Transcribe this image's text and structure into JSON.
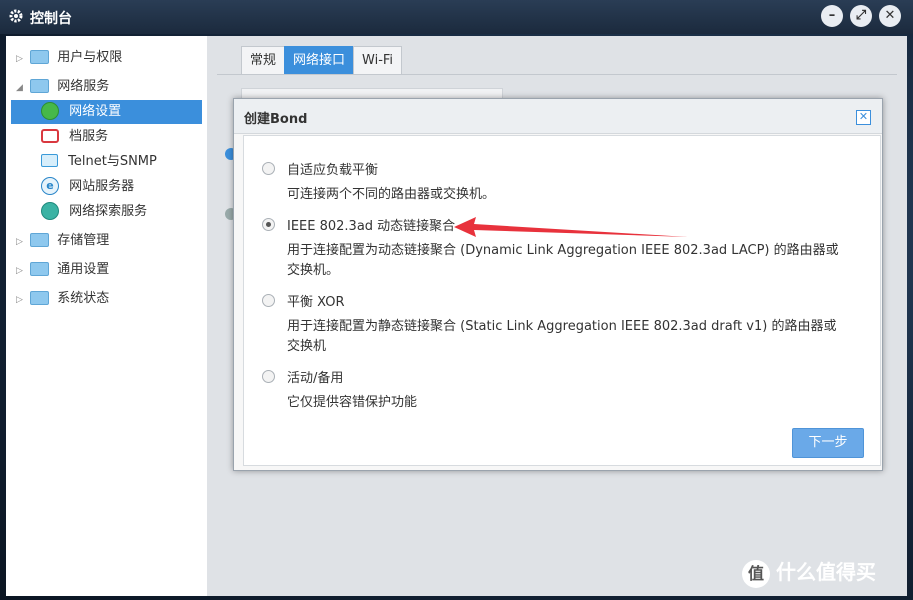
{
  "window": {
    "title": "控制台",
    "buttons": [
      "–",
      "⤢",
      "✕"
    ]
  },
  "sidebar": {
    "items": [
      {
        "label": "用户与权限",
        "arrow": "▷"
      },
      {
        "label": "网络服务",
        "arrow": "◢"
      },
      {
        "label": "网络设置"
      },
      {
        "label": "档服务"
      },
      {
        "label": "Telnet与SNMP"
      },
      {
        "label": "网站服务器"
      },
      {
        "label": "网络探索服务"
      },
      {
        "label": "存储管理",
        "arrow": "▷"
      },
      {
        "label": "通用设置",
        "arrow": "▷"
      },
      {
        "label": "系统状态",
        "arrow": "▷"
      }
    ]
  },
  "main": {
    "tabs": [
      {
        "label": "常规"
      },
      {
        "label": "网络接口"
      },
      {
        "label": "Wi-Fi"
      }
    ]
  },
  "dialog": {
    "title": "创建Bond",
    "options": [
      {
        "label": "自适应负载平衡",
        "desc": [
          "可连接两个不同的路由器或交换机。"
        ],
        "checked": false
      },
      {
        "label": "IEEE 802.3ad 动态链接聚合",
        "desc": [
          "用于连接配置为动态链接聚合 (Dynamic Link Aggregation IEEE 802.3ad LACP) 的路由器或",
          "交换机。"
        ],
        "checked": true
      },
      {
        "label": "平衡 XOR",
        "desc": [
          "用于连接配置为静态链接聚合 (Static Link Aggregation IEEE 802.3ad draft v1) 的路由器或",
          "交换机"
        ],
        "checked": false
      },
      {
        "label": "活动/备用",
        "desc": [
          "它仅提供容错保护功能"
        ],
        "checked": false
      }
    ],
    "next_label": "下一步"
  },
  "watermark": {
    "logo": "值",
    "text": "什么值得买"
  },
  "colors": {
    "accent": "#3b8fdc",
    "arrow": "#e8323c"
  }
}
